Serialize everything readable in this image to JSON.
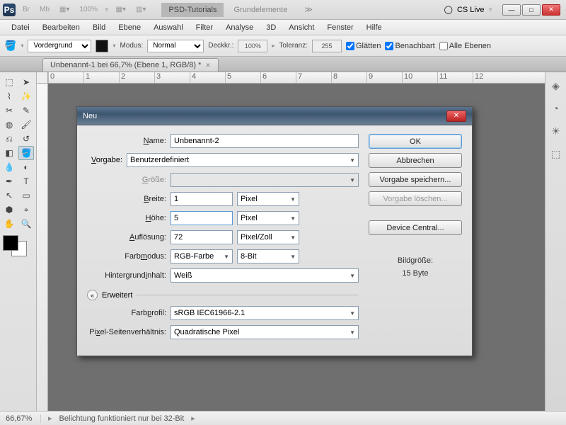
{
  "titlebar": {
    "app": "Ps",
    "mini_btns": [
      "Br",
      "Mb"
    ],
    "zoom": "100%",
    "tabs": [
      {
        "label": "PSD-Tutorials",
        "active": true
      },
      {
        "label": "Grundelemente",
        "active": false
      }
    ],
    "cslive": "CS Live"
  },
  "menu": [
    "Datei",
    "Bearbeiten",
    "Bild",
    "Ebene",
    "Auswahl",
    "Filter",
    "Analyse",
    "3D",
    "Ansicht",
    "Fenster",
    "Hilfe"
  ],
  "options": {
    "target": "Vordergrund",
    "mode_label": "Modus:",
    "mode_value": "Normal",
    "opacity_label": "Deckkr.:",
    "opacity_value": "100%",
    "tolerance_label": "Toleranz:",
    "tolerance_value": "255",
    "antialias": "Glätten",
    "contiguous": "Benachbart",
    "all_layers": "Alle Ebenen"
  },
  "doc_tab": "Unbenannt-1 bei 66,7% (Ebene 1, RGB/8) *",
  "ruler_ticks": [
    "0",
    "1",
    "2",
    "3",
    "4",
    "5",
    "6",
    "7",
    "8",
    "9",
    "10",
    "11",
    "12"
  ],
  "status": {
    "zoom": "66,67%",
    "msg": "Belichtung funktioniert nur bei 32-Bit"
  },
  "dialog": {
    "title": "Neu",
    "name_label": "Name:",
    "name_value": "Unbenannt-2",
    "preset_label": "Vorgabe:",
    "preset_value": "Benutzerdefiniert",
    "size_label": "Größe:",
    "width_label": "Breite:",
    "width_value": "1",
    "width_unit": "Pixel",
    "height_label": "Höhe:",
    "height_value": "5",
    "height_unit": "Pixel",
    "res_label": "Auflösung:",
    "res_value": "72",
    "res_unit": "Pixel/Zoll",
    "color_label": "Farbmodus:",
    "color_value": "RGB-Farbe",
    "bit_value": "8-Bit",
    "bg_label": "Hintergrundinhalt:",
    "bg_value": "Weiß",
    "advanced": "Erweitert",
    "profile_label": "Farbprofil:",
    "profile_value": "sRGB IEC61966-2.1",
    "aspect_label": "Pixel-Seitenverhältnis:",
    "aspect_value": "Quadratische Pixel",
    "btn_ok": "OK",
    "btn_cancel": "Abbrechen",
    "btn_save": "Vorgabe speichern...",
    "btn_delete": "Vorgabe löschen...",
    "btn_device": "Device Central...",
    "filesize_label": "Bildgröße:",
    "filesize": "15 Byte"
  }
}
